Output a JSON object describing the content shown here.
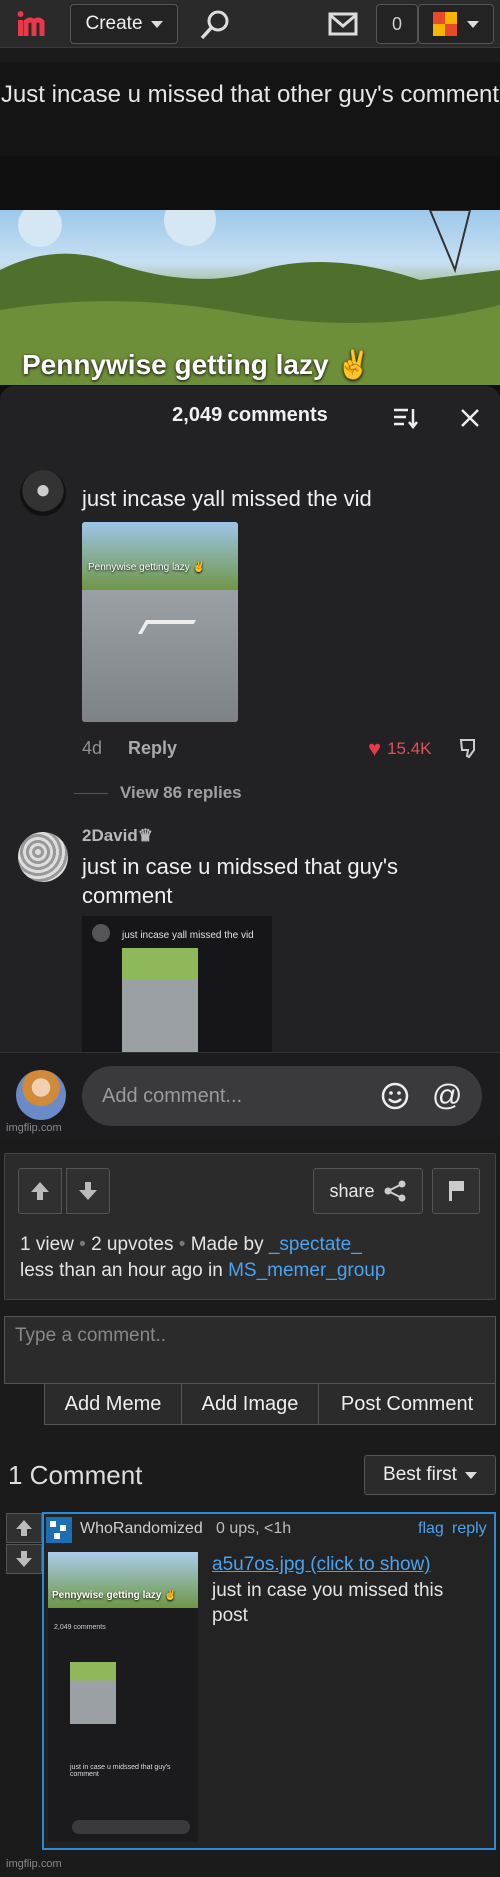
{
  "nav": {
    "create_label": "Create",
    "notification_count": "0"
  },
  "meme": {
    "caption": "Just incase u missed that other guy's comment",
    "photo_title": "Pennywise getting lazy ✌️",
    "comments_header": "2,049 comments",
    "comment1": {
      "text": "just incase yall missed the vid",
      "thumb_label": "Pennywise getting lazy ✌️",
      "age": "4d",
      "reply": "Reply",
      "likes": "15.4K",
      "view_replies": "View 86 replies"
    },
    "comment2": {
      "user": "2David♛",
      "text": "just in case u midssed that guy's comment",
      "embedded_text": "just incase yall missed the vid"
    },
    "add_comment_placeholder": "Add comment...",
    "watermark": "imgflip.com"
  },
  "panel": {
    "share_label": "share",
    "views": "1 view",
    "upvotes": "2 upvotes",
    "made_by_label": "Made by",
    "author": "_spectate_",
    "time_label": "less than an hour ago in",
    "stream": "MS_memer_group"
  },
  "comment_form": {
    "placeholder": "Type a comment..",
    "add_meme": "Add Meme",
    "add_image": "Add Image",
    "post_comment": "Post Comment"
  },
  "comments": {
    "count_label": "1 Comment",
    "sort_label": "Best first",
    "items": [
      {
        "user": "WhoRandomized",
        "meta": "0 ups, <1h",
        "flag": "flag",
        "reply": "reply",
        "link": "a5u7os.jpg (click to show)",
        "text": "just in case you missed this post",
        "img_title": "Pennywise getting lazy ✌️",
        "img_header": "2,049 comments",
        "img_text": "just in case u midssed that guy's comment"
      }
    ]
  },
  "footer_watermark": "imgflip.com",
  "colors": {
    "link": "#4aa3f0",
    "accent_border": "#2d8ad6",
    "heart": "#e8394a"
  }
}
